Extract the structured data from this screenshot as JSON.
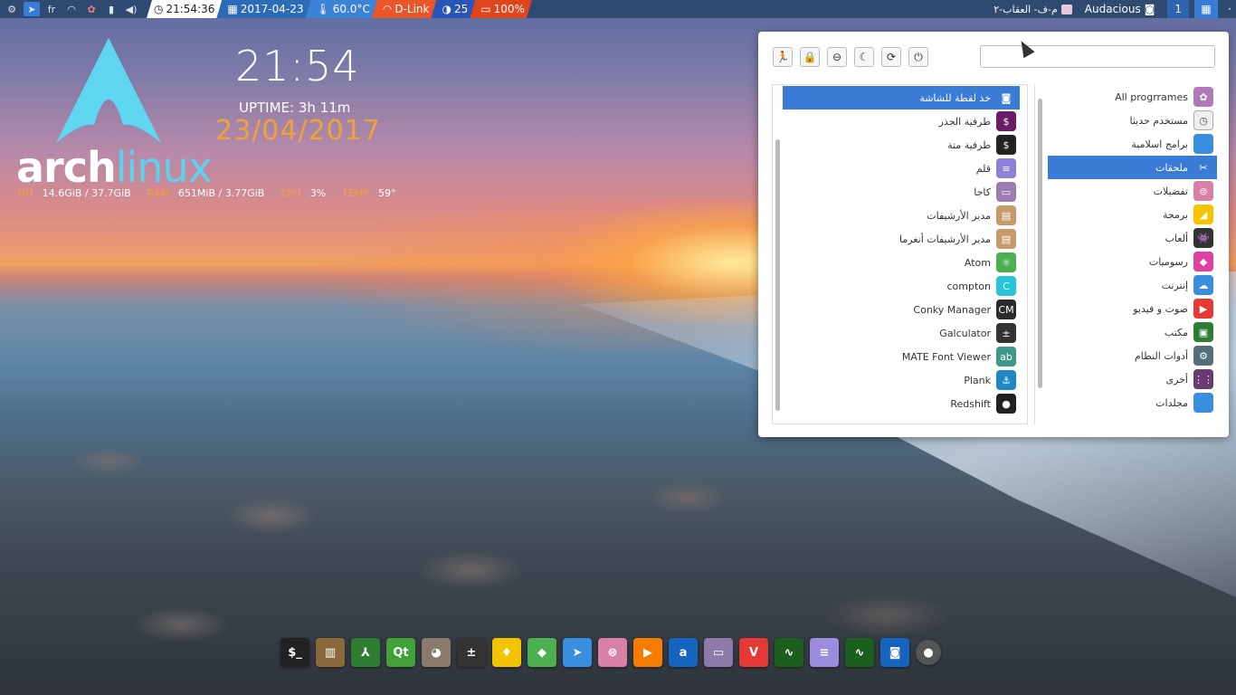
{
  "panel": {
    "lang": "fr",
    "time": "21:54:36",
    "date": "2017-04-23",
    "temp": "60.0°C",
    "wifi": "D-Link",
    "brightness": "25",
    "battery": "100%",
    "window_title": "م-ف- العقاب-٢",
    "app_title": "Audacious",
    "workspace": "1"
  },
  "conky": {
    "clock": "21:54",
    "uptime": "UPTIME: 3h 11m",
    "date": "23/04/2017",
    "logo_arch": "arch",
    "logo_linux": "linux",
    "hd_label": "HD",
    "hd_value": "14.6GiB / 37.7GiB",
    "ram_label": "RAM",
    "ram_value": "651MiB / 3.77GiB",
    "cpu_label": "CPU",
    "cpu_value": "3%",
    "temp_label": "TEMP",
    "temp_value": "59°"
  },
  "menu": {
    "search_placeholder": "",
    "power_buttons": [
      {
        "name": "logout-icon",
        "glyph": "🏃"
      },
      {
        "name": "lock-icon",
        "glyph": "🔒"
      },
      {
        "name": "switch-user-icon",
        "glyph": "⊖"
      },
      {
        "name": "suspend-icon",
        "glyph": "☾"
      },
      {
        "name": "restart-icon",
        "glyph": "⟳"
      },
      {
        "name": "shutdown-icon",
        "glyph": "⏻"
      }
    ],
    "apps": [
      {
        "label": "خذ لقطة للشاشة",
        "icon": "camera-icon",
        "color": "#3a7bd5",
        "glyph": "◙",
        "selected": true
      },
      {
        "label": "طرفية الجذر",
        "icon": "root-terminal-icon",
        "color": "#6a1b6a",
        "glyph": "$"
      },
      {
        "label": "طرفية متة",
        "icon": "terminal-icon",
        "color": "#222222",
        "glyph": "$"
      },
      {
        "label": "قلم",
        "icon": "text-editor-icon",
        "color": "#8c80d8",
        "glyph": "≡"
      },
      {
        "label": "كاجا",
        "icon": "file-manager-icon",
        "color": "#9c7bb0",
        "glyph": "▭"
      },
      {
        "label": "مدير الأرشيفات",
        "icon": "archive-manager-icon",
        "color": "#c89a6a",
        "glyph": "▤"
      },
      {
        "label": "مدير الأرشيفات أنغرما",
        "icon": "archive-engrampa-icon",
        "color": "#c89a6a",
        "glyph": "▤"
      },
      {
        "label": "Atom",
        "icon": "atom-icon",
        "color": "#4caf50",
        "glyph": "⚛"
      },
      {
        "label": "compton",
        "icon": "compton-icon",
        "color": "#26c6da",
        "glyph": "C"
      },
      {
        "label": "Conky Manager",
        "icon": "conky-manager-icon",
        "color": "#2b2b2b",
        "glyph": "CM"
      },
      {
        "label": "Galculator",
        "icon": "calculator-icon",
        "color": "#333333",
        "glyph": "±"
      },
      {
        "label": "MATE Font Viewer",
        "icon": "font-viewer-icon",
        "color": "#3d9a8a",
        "glyph": "ab"
      },
      {
        "label": "Plank",
        "icon": "plank-icon",
        "color": "#1e88c8",
        "glyph": "⚓"
      },
      {
        "label": "Redshift",
        "icon": "redshift-icon",
        "color": "#222222",
        "glyph": "●"
      }
    ],
    "categories": [
      {
        "label": "All progrrames",
        "icon": "all-programs-icon",
        "color": "#b07ab8",
        "glyph": "✿"
      },
      {
        "label": "مستخدم حديثا",
        "icon": "recent-icon",
        "color": "#eeeeee",
        "glyph": "◷"
      },
      {
        "label": "برامج اسلامية",
        "icon": "folder-icon",
        "color": "#3a8ee0",
        "glyph": ""
      },
      {
        "label": "ملحقات",
        "icon": "accessories-icon",
        "color": "#3a7bd5",
        "glyph": "✂",
        "selected": true
      },
      {
        "label": "تفضيلات",
        "icon": "preferences-icon",
        "color": "#d880a8",
        "glyph": "⊜"
      },
      {
        "label": "برمجة",
        "icon": "programming-icon",
        "color": "#f5c400",
        "glyph": "◢"
      },
      {
        "label": "ألعاب",
        "icon": "games-icon",
        "color": "#333333",
        "glyph": "👾"
      },
      {
        "label": "رسوميات",
        "icon": "graphics-icon",
        "color": "#e040a0",
        "glyph": "◆"
      },
      {
        "label": "إنترنت",
        "icon": "internet-icon",
        "color": "#3a8ee0",
        "glyph": "☁"
      },
      {
        "label": "صوت و فيديو",
        "icon": "multimedia-icon",
        "color": "#e53935",
        "glyph": "▶"
      },
      {
        "label": "مكتب",
        "icon": "office-icon",
        "color": "#2e7d32",
        "glyph": "▣"
      },
      {
        "label": "أدوات النظام",
        "icon": "system-tools-icon",
        "color": "#546e7a",
        "glyph": "⚙"
      },
      {
        "label": "أخرى",
        "icon": "other-icon",
        "color": "#6a3b70",
        "glyph": "⋮⋮"
      },
      {
        "label": "مجلدات",
        "icon": "folders-icon",
        "color": "#3a8ee0",
        "glyph": ""
      }
    ]
  },
  "dock": [
    {
      "icon": "terminal-icon",
      "color": "#222222",
      "glyph": "$_"
    },
    {
      "icon": "archive-icon",
      "color": "#8a6a3a",
      "glyph": "▥"
    },
    {
      "icon": "pdf-viewer-icon",
      "color": "#2e7d32",
      "glyph": "⅄"
    },
    {
      "icon": "qt-creator-icon",
      "color": "#41a037",
      "glyph": "Qt"
    },
    {
      "icon": "gimp-icon",
      "color": "#8a7a6a",
      "glyph": "◕"
    },
    {
      "icon": "calculator-icon",
      "color": "#333333",
      "glyph": "±"
    },
    {
      "icon": "game-icon",
      "color": "#f5c400",
      "glyph": "♦"
    },
    {
      "icon": "gem-icon",
      "color": "#4caf50",
      "glyph": "◆"
    },
    {
      "icon": "pointer-icon",
      "color": "#3a8ee0",
      "glyph": "➤"
    },
    {
      "icon": "settings-toggle-icon",
      "color": "#d880a8",
      "glyph": "⊜"
    },
    {
      "icon": "media-player-icon",
      "color": "#f57c00",
      "glyph": "▶"
    },
    {
      "icon": "audacious-icon",
      "color": "#1565c0",
      "glyph": "a"
    },
    {
      "icon": "file-manager-icon",
      "color": "#8e7aa8",
      "glyph": "▭"
    },
    {
      "icon": "vivaldi-icon",
      "color": "#e53935",
      "glyph": "V"
    },
    {
      "icon": "system-monitor-icon",
      "color": "#1b5e20",
      "glyph": "∿"
    },
    {
      "icon": "text-editor-icon",
      "color": "#9c8ce0",
      "glyph": "≡"
    },
    {
      "icon": "activity-monitor-icon",
      "color": "#1b5e20",
      "glyph": "∿"
    },
    {
      "icon": "screenshot-icon",
      "color": "#1565c0",
      "glyph": "◙"
    },
    {
      "icon": "speaker-icon",
      "color": "#555555",
      "glyph": "●"
    }
  ]
}
